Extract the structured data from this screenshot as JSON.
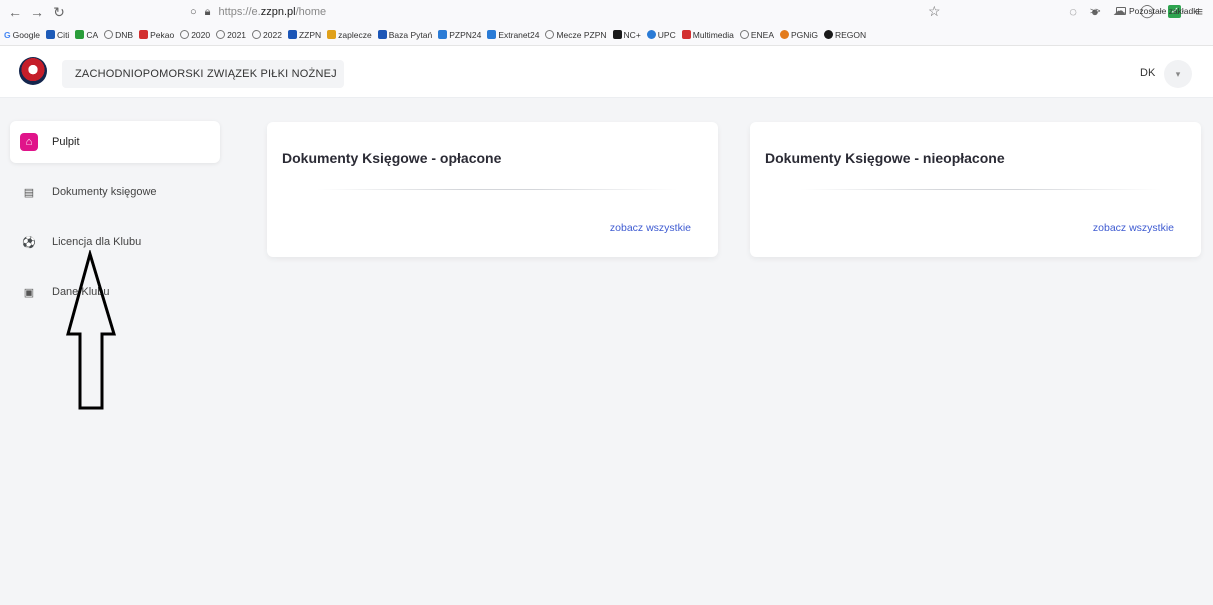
{
  "browser": {
    "url_prefix": "https://e.",
    "url_domain": "zzpn.pl",
    "url_path": "/home",
    "bookmarks": [
      {
        "label": "Google",
        "color": "#4285f4"
      },
      {
        "label": "Citi",
        "color": "#1e5bb8"
      },
      {
        "label": "CA",
        "color": "#2a9d3a"
      },
      {
        "label": "DNB",
        "color": ""
      },
      {
        "label": "Pekao",
        "color": "#d32f2f"
      },
      {
        "label": "2020",
        "color": ""
      },
      {
        "label": "2021",
        "color": ""
      },
      {
        "label": "2022",
        "color": ""
      },
      {
        "label": "ZZPN",
        "color": "#1c56b7"
      },
      {
        "label": "zaplecze",
        "color": "#e0a11b"
      },
      {
        "label": "Baza Pytań",
        "color": "#1c56b7"
      },
      {
        "label": "PZPN24",
        "color": "#2a7bd6"
      },
      {
        "label": "Extranet24",
        "color": "#2a7bd6"
      },
      {
        "label": "Mecze PZPN",
        "color": ""
      },
      {
        "label": "NC+",
        "color": "#1a1a1a"
      },
      {
        "label": "UPC",
        "color": "#2a7bd6"
      },
      {
        "label": "Multimedia",
        "color": "#d32f2f"
      },
      {
        "label": "ENEA",
        "color": ""
      },
      {
        "label": "PGNiG",
        "color": "#e37b1d"
      },
      {
        "label": "REGON",
        "color": "#1a1a1a"
      }
    ],
    "bookmarks_more": ">>",
    "other_bookmarks": "Pozostałe zakładki"
  },
  "header": {
    "org_name": "ZACHODNIOPOMORSKI ZWIĄZEK PIŁKI NOŻNEJ",
    "user_initials": "DK",
    "user_menu_glyph": "▾"
  },
  "sidebar": {
    "items": [
      {
        "label": "Pulpit",
        "icon": "home-icon",
        "glyph": "⌂",
        "active": true
      },
      {
        "label": "Dokumenty księgowe",
        "icon": "document-icon",
        "glyph": "▤",
        "active": false
      },
      {
        "label": "Licencja dla Klubu",
        "icon": "football-icon",
        "glyph": "⚽",
        "active": false
      },
      {
        "label": "Dane Klubu",
        "icon": "clipboard-icon",
        "glyph": "▣",
        "active": false
      }
    ]
  },
  "cards": [
    {
      "title": "Dokumenty Księgowe - opłacone",
      "link": "zobacz wszystkie"
    },
    {
      "title": "Dokumenty Księgowe - nieopłacone",
      "link": "zobacz wszystkie"
    }
  ],
  "colors": {
    "accent": "#e0148a",
    "link": "#3d5ad1",
    "background": "#f4f5f7"
  }
}
